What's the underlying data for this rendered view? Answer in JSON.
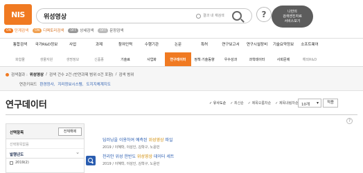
{
  "header": {
    "logo_text": "NIS",
    "search_value": "위성영상",
    "radio_label": "결과 내 재검색",
    "bubble": "?",
    "promo_line1": "나만의",
    "promo_line2": "검색엔진자료",
    "promo_line3": "서비스보기"
  },
  "modes": [
    {
      "tag": "ON",
      "label": "단계검색"
    },
    {
      "tag": "ON",
      "label": "디렉토리검색"
    },
    {
      "tag": "OFF",
      "label": "상세검색"
    },
    {
      "tag": "OFF",
      "label": "문장검색"
    }
  ],
  "nav_row1": [
    "통합검색",
    "국가R&D정보",
    "사업",
    "과제",
    "참여인력",
    "수행기관",
    "논문",
    "특허",
    "연구보고서",
    "연구시설장비",
    "기술요약정보",
    "소프트웨어"
  ],
  "nav_row2": [
    "화합물",
    "생물자원",
    "생명정보",
    "신품종",
    "기술료",
    "사업화",
    "연구데이터",
    "정책·기술동향",
    "우수성과",
    "과학데이터",
    "사회문제",
    "해외R&D"
  ],
  "condition": {
    "prefix": "검색결과 : ",
    "query": "위성영상",
    "count": "검색 건수 2건 (반연과제 범위 0건 포함)",
    "scope": "검색 범위"
  },
  "keywords": {
    "label": "연관키워드",
    "items": [
      "환경정사,",
      "지리정보시스템,",
      "도지지체계지도"
    ]
  },
  "main": {
    "title": "연구데이터",
    "sort_options": [
      "유사도순",
      "최신순",
      "제목오름차순",
      "제목내림차순"
    ],
    "page_size": "10개",
    "apply_label": "적용",
    "help": "?"
  },
  "sidebar": {
    "title": "선택항목",
    "clear_label": "전체해제",
    "placeholder": "선택항목없음",
    "group": "발행년도",
    "items": [
      "2019(2)"
    ]
  },
  "results": [
    {
      "title_pre": "딥러닝을 이용하여 예측된 ",
      "highlight": "위성영상",
      "title_post": " 파일",
      "meta": "2019 / 이혜학, 이성인, 김학구, 노윤민"
    },
    {
      "title_pre": "천리안 위성 한반도 ",
      "highlight": "위성영상",
      "title_post": " 데이터 세트",
      "meta": "2019 / 이혜학, 이성인, 김학구, 노윤민"
    }
  ]
}
